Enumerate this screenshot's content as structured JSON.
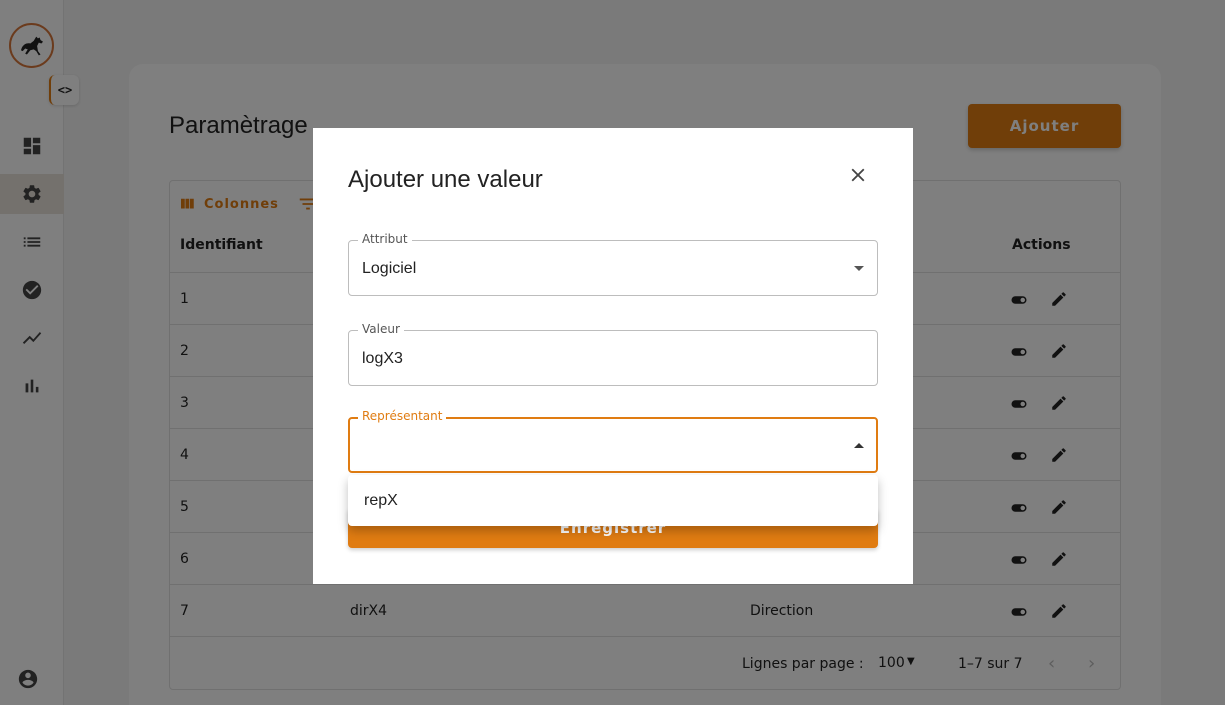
{
  "sidebar": {
    "toggle_label": "<>",
    "items": [
      {
        "icon": "dashboard-icon"
      },
      {
        "icon": "gear-icon",
        "active": true
      },
      {
        "icon": "list-icon"
      },
      {
        "icon": "check-circle-icon"
      },
      {
        "icon": "trending-icon"
      },
      {
        "icon": "bar-chart-icon"
      }
    ],
    "user_icon": "account-circle-icon"
  },
  "page": {
    "title": "Paramètrage",
    "add_label": "Ajouter"
  },
  "grid": {
    "toolbar": {
      "columns_label": "Colonnes"
    },
    "headers": {
      "id": "Identifiant",
      "actions": "Actions"
    },
    "rows": [
      {
        "id": "1",
        "value": "",
        "attribute": ""
      },
      {
        "id": "2",
        "value": "",
        "attribute": ""
      },
      {
        "id": "3",
        "value": "",
        "attribute": ""
      },
      {
        "id": "4",
        "value": "",
        "attribute": ""
      },
      {
        "id": "5",
        "value": "",
        "attribute": ""
      },
      {
        "id": "6",
        "value": "",
        "attribute": ""
      },
      {
        "id": "7",
        "value": "dirX4",
        "attribute": "Direction"
      }
    ],
    "footer": {
      "rows_per_page_label": "Lignes par page :",
      "rows_per_page": "100",
      "range": "1–7 sur 7"
    }
  },
  "modal": {
    "title": "Ajouter une valeur",
    "fields": {
      "attribut": {
        "label": "Attribut",
        "value": "Logiciel"
      },
      "valeur": {
        "label": "Valeur",
        "value": "logX3"
      },
      "representant": {
        "label": "Représentant",
        "value": ""
      }
    },
    "save_label": "Enregistrer"
  },
  "dropdown": {
    "options": [
      "repX"
    ]
  },
  "colors": {
    "accent": "#e07c12",
    "overlay": "rgba(0,0,0,0.5)"
  }
}
